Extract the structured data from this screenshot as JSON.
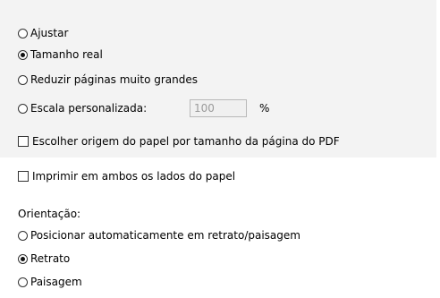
{
  "scaling": {
    "options": [
      {
        "label": "Ajustar",
        "checked": false
      },
      {
        "label": "Tamanho real",
        "checked": true
      },
      {
        "label": "Reduzir páginas muito grandes",
        "checked": false
      },
      {
        "label": "Escala personalizada:",
        "checked": false
      }
    ],
    "custom_scale_value": "100",
    "percent_label": "%",
    "paper_source_checkbox": {
      "label": "Escolher origem do papel por tamanho da página do PDF",
      "checked": false
    }
  },
  "duplex": {
    "label": "Imprimir em ambos os lados do papel",
    "checked": false
  },
  "orientation": {
    "heading": "Orientação:",
    "options": [
      {
        "label": "Posicionar automaticamente em retrato/paisagem",
        "checked": false
      },
      {
        "label": "Retrato",
        "checked": true
      },
      {
        "label": "Paisagem",
        "checked": false
      }
    ]
  }
}
